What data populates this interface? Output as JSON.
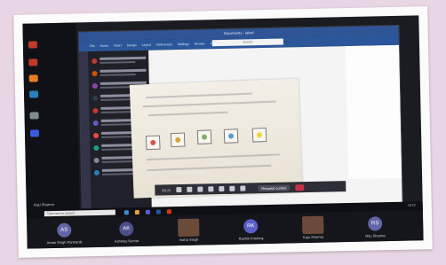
{
  "window": {
    "title": "Document1 - Word"
  },
  "ribbon": {
    "tabs": [
      "File",
      "Home",
      "Insert",
      "Design",
      "Layout",
      "References",
      "Mailings",
      "Review",
      "View",
      "Help"
    ]
  },
  "search": {
    "placeholder": "Search"
  },
  "call": {
    "time": "00:25",
    "request_control_label": "Request control"
  },
  "taskbar": {
    "search_placeholder": "Type here to search",
    "clock": "15:22"
  },
  "host_name": "Kaju Sharma",
  "participants": [
    {
      "name": "Aman Singh Parmanik",
      "initials": "AS",
      "color": "#6264a7"
    },
    {
      "name": "Ashmay Kumar",
      "initials": "AK",
      "color": "#4b4f8a"
    },
    {
      "name": "Astha Singh",
      "initials": "",
      "color": "#6b4a3a"
    },
    {
      "name": "Rashiti Krishnaj",
      "initials": "RK",
      "color": "#5b5fc7"
    },
    {
      "name": "Kaju Sharma",
      "initials": "",
      "color": "#6b4a3a"
    },
    {
      "name": "Ritu Sharma",
      "initials": "RS",
      "color": "#6264a7"
    }
  ],
  "colors": {
    "accent": "#2b579a",
    "teams": "#6264a7",
    "end_call": "#c4314b"
  },
  "icons": [
    "camera-icon",
    "mic-icon",
    "share-icon",
    "more-icon",
    "raise-hand-icon",
    "chat-icon",
    "people-icon",
    "hangup-icon"
  ]
}
